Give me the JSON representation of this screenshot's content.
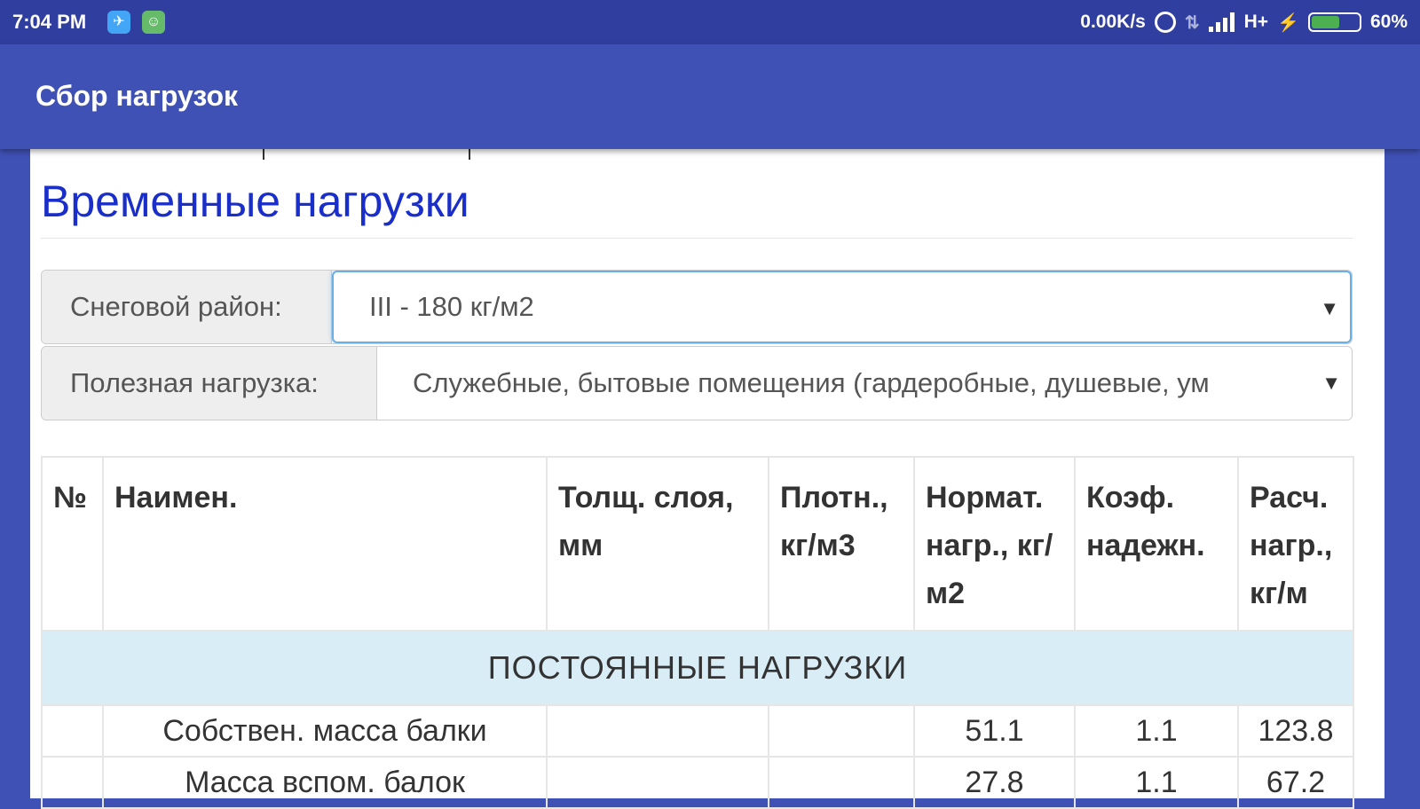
{
  "status_bar": {
    "time": "7:04 PM",
    "speed": "0.00K/s",
    "network": "H+",
    "battery": "60%",
    "battery_level": 0.6,
    "icons": [
      "telegram-icon",
      "android-icon",
      "alarm-icon",
      "data-transfer-icon",
      "signal-icon",
      "charging-icon",
      "battery-icon"
    ]
  },
  "app_bar": {
    "title": "Сбор нагрузок"
  },
  "section": {
    "title": "Временные нагрузки"
  },
  "form": {
    "snow_region": {
      "label": "Снеговой район:",
      "value": "III - 180 кг/м2"
    },
    "useful_load": {
      "label": "Полезная нагрузка:",
      "value": "Служебные, бытовые помещения (гардеробные, душевые, ум"
    }
  },
  "table": {
    "headers": {
      "num": "№",
      "name": "Наимен.",
      "thickness": "Толщ. слоя, мм",
      "density": "Плотн., кг/м3",
      "norm_load": "Нормат. нагр., кг/м2",
      "coef": "Коэф. надежн.",
      "calc_load": "Расч. нагр., кг/м"
    },
    "group_title": "ПОСТОЯННЫЕ НАГРУЗКИ",
    "rows": [
      {
        "num": "",
        "name": "Собствен. масса балки",
        "thickness": "",
        "density": "",
        "norm_load": "51.1",
        "coef": "1.1",
        "calc_load": "123.8"
      },
      {
        "num": "",
        "name": "Масса вспом. балок",
        "thickness": "",
        "density": "",
        "norm_load": "27.8",
        "coef": "1.1",
        "calc_load": "67.2"
      }
    ]
  },
  "colors": {
    "app_bar": "#3f51b5",
    "status_bar": "#303f9f",
    "title_blue": "#1a2ec9",
    "group_row": "#d9edf7"
  }
}
